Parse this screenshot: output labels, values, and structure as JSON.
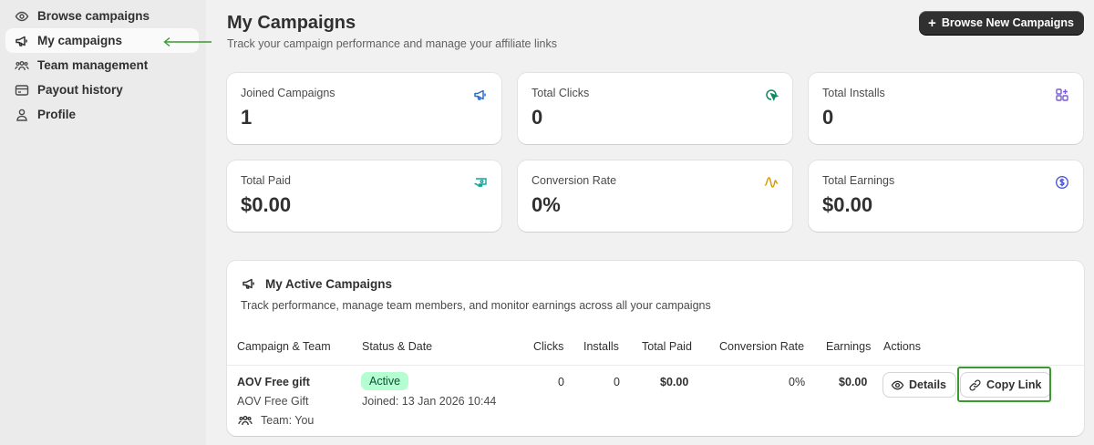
{
  "sidebar": {
    "items": [
      {
        "label": "Browse campaigns",
        "icon": "eye-icon"
      },
      {
        "label": "My campaigns",
        "icon": "megaphone-icon",
        "active": true
      },
      {
        "label": "Team management",
        "icon": "team-icon"
      },
      {
        "label": "Payout history",
        "icon": "credit-card-icon"
      },
      {
        "label": "Profile",
        "icon": "person-icon"
      }
    ]
  },
  "header": {
    "title": "My Campaigns",
    "subtitle": "Track your campaign performance and manage your affiliate links",
    "browse_button": "Browse New Campaigns"
  },
  "stats": [
    {
      "label": "Joined Campaigns",
      "value": "1",
      "icon": "megaphone-icon",
      "color": "#2c6ecb"
    },
    {
      "label": "Total Clicks",
      "value": "0",
      "icon": "cursor-click-icon",
      "color": "#0e8a5f"
    },
    {
      "label": "Total Installs",
      "value": "0",
      "icon": "apps-icon",
      "color": "#7b5cd6"
    },
    {
      "label": "Total Paid",
      "value": "$0.00",
      "icon": "cash-icon",
      "color": "#12a59a"
    },
    {
      "label": "Conversion Rate",
      "value": "0%",
      "icon": "pulse-icon",
      "color": "#d99a00"
    },
    {
      "label": "Total Earnings",
      "value": "$0.00",
      "icon": "dollar-circle-icon",
      "color": "#4f57d6"
    }
  ],
  "active_campaigns": {
    "title": "My Active Campaigns",
    "subtitle": "Track performance, manage team members, and monitor earnings across all your campaigns",
    "columns": [
      "Campaign & Team",
      "Status & Date",
      "Clicks",
      "Installs",
      "Total Paid",
      "Conversion Rate",
      "Earnings",
      "Actions"
    ],
    "rows": [
      {
        "name": "AOV Free gift",
        "subname": "AOV Free Gift",
        "team": "Team: You",
        "status": "Active",
        "joined": "Joined: 13 Jan 2026 10:44",
        "clicks": "0",
        "installs": "0",
        "total_paid": "$0.00",
        "conversion_rate": "0%",
        "earnings": "$0.00",
        "details_label": "Details",
        "copy_label": "Copy Link"
      }
    ]
  },
  "colors": {
    "accent_dark": "#303030",
    "badge_bg": "#b4fed2",
    "highlight": "#3a9a2e"
  }
}
